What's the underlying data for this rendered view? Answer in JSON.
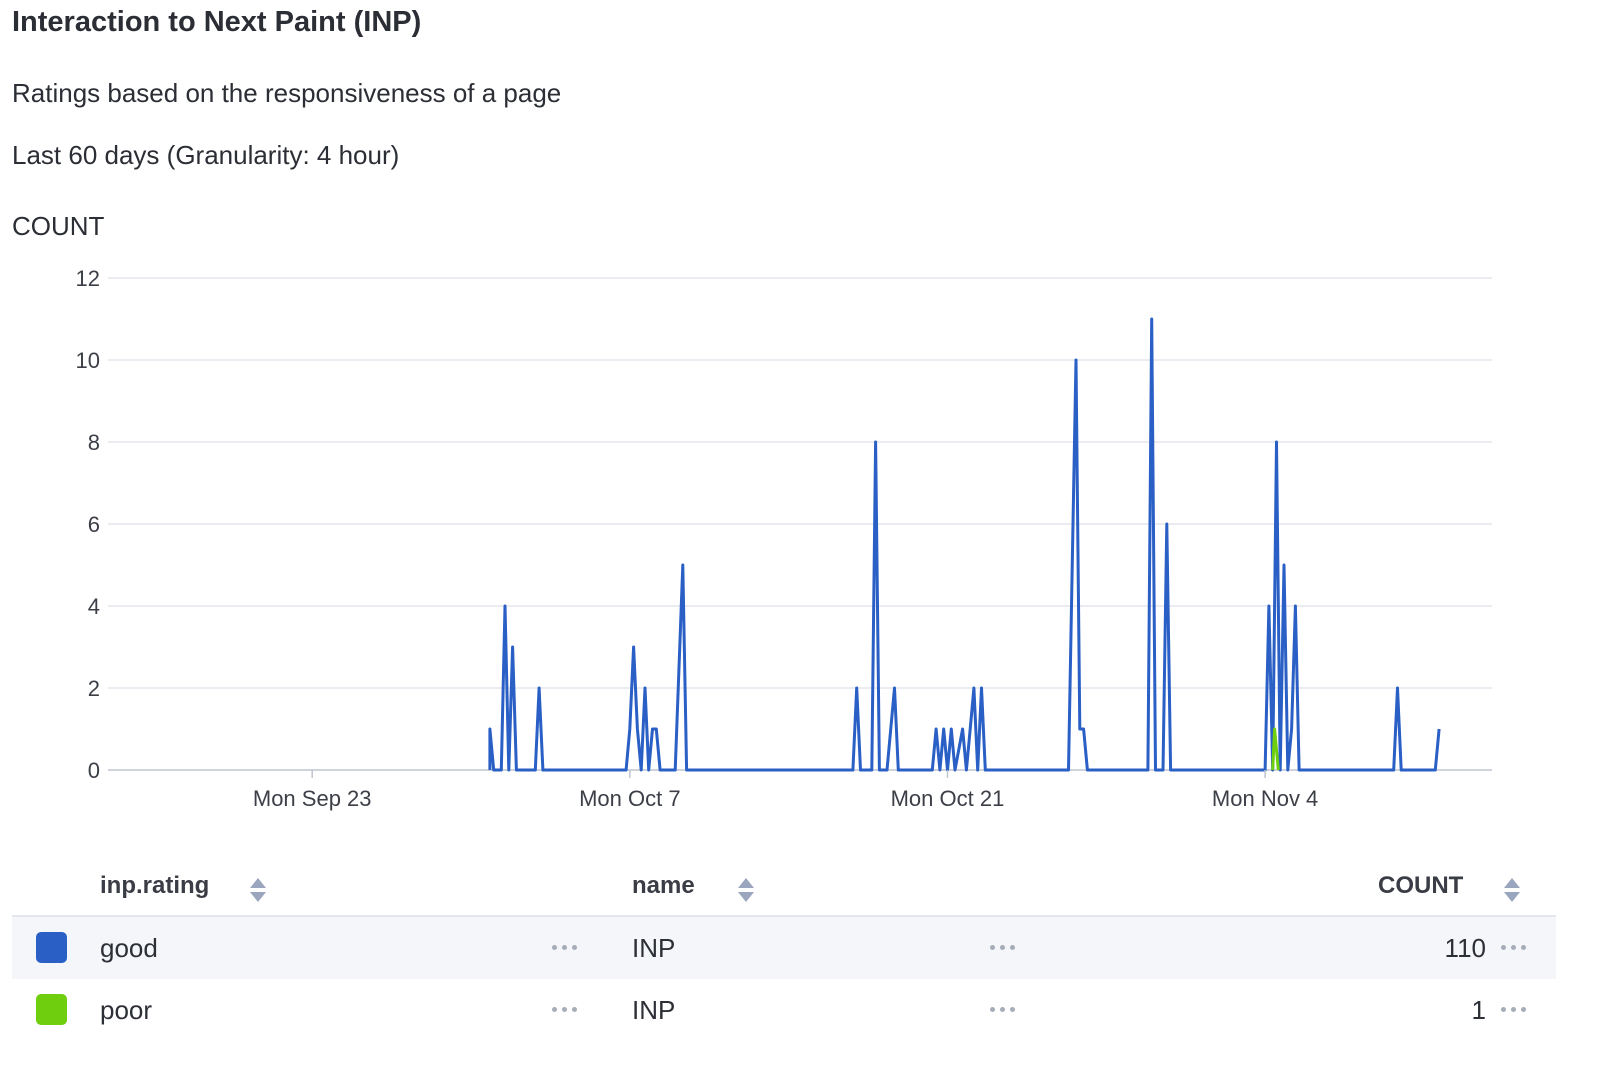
{
  "title": "Interaction to Next Paint (INP)",
  "subtitle": "Ratings based on the responsiveness of a page",
  "time_range": "Last 60 days (Granularity: 4 hour)",
  "y_axis_label": "COUNT",
  "colors": {
    "good": "#2a5fc5",
    "poor": "#6fcf0e",
    "grid": "#e3e6ee",
    "axis": "#bfc5d1"
  },
  "chart_data": {
    "type": "line",
    "title": "Interaction to Next Paint (INP)",
    "ylabel": "COUNT",
    "ylim": [
      0,
      12
    ],
    "yticks": [
      "0",
      "2",
      "4",
      "6",
      "8",
      "10",
      "12"
    ],
    "xlim": [
      "2024-09-14",
      "2024-11-14"
    ],
    "xticks": [
      {
        "label": "Mon Sep 23",
        "x": "2024-09-23"
      },
      {
        "label": "Mon Oct 7",
        "x": "2024-10-07"
      },
      {
        "label": "Mon Oct 21",
        "x": "2024-10-21"
      },
      {
        "label": "Mon Nov 4",
        "x": "2024-11-04"
      }
    ],
    "grid": true,
    "series": [
      {
        "name": "good",
        "color": "#2a5fc5",
        "points": [
          [
            "2024-09-30 20:00",
            0
          ],
          [
            "2024-09-30 20:00",
            1
          ],
          [
            "2024-09-31 00:00",
            0
          ],
          [
            "2024-10-01 08:00",
            0
          ],
          [
            "2024-10-01 12:00",
            4
          ],
          [
            "2024-10-01 16:00",
            0
          ],
          [
            "2024-10-01 20:00",
            3
          ],
          [
            "2024-10-02 00:00",
            0
          ],
          [
            "2024-10-02 20:00",
            0
          ],
          [
            "2024-10-03 00:00",
            2
          ],
          [
            "2024-10-03 04:00",
            0
          ],
          [
            "2024-10-06 20:00",
            0
          ],
          [
            "2024-10-07 00:00",
            1
          ],
          [
            "2024-10-07 04:00",
            3
          ],
          [
            "2024-10-07 08:00",
            1
          ],
          [
            "2024-10-07 12:00",
            0
          ],
          [
            "2024-10-07 16:00",
            2
          ],
          [
            "2024-10-07 20:00",
            0
          ],
          [
            "2024-10-08 00:00",
            1
          ],
          [
            "2024-10-08 04:00",
            1
          ],
          [
            "2024-10-08 08:00",
            0
          ],
          [
            "2024-10-09 00:00",
            0
          ],
          [
            "2024-10-09 08:00",
            5
          ],
          [
            "2024-10-09 12:00",
            0
          ],
          [
            "2024-10-16 20:00",
            0
          ],
          [
            "2024-10-17 00:00",
            2
          ],
          [
            "2024-10-17 04:00",
            0
          ],
          [
            "2024-10-17 16:00",
            0
          ],
          [
            "2024-10-17 20:00",
            8
          ],
          [
            "2024-10-18 00:00",
            0
          ],
          [
            "2024-10-18 08:00",
            0
          ],
          [
            "2024-10-18 16:00",
            2
          ],
          [
            "2024-10-18 20:00",
            0
          ],
          [
            "2024-10-20 08:00",
            0
          ],
          [
            "2024-10-20 12:00",
            1
          ],
          [
            "2024-10-20 16:00",
            0
          ],
          [
            "2024-10-20 20:00",
            1
          ],
          [
            "2024-10-21 00:00",
            0
          ],
          [
            "2024-10-21 04:00",
            1
          ],
          [
            "2024-10-21 08:00",
            0
          ],
          [
            "2024-10-21 16:00",
            1
          ],
          [
            "2024-10-21 20:00",
            0
          ],
          [
            "2024-10-22 00:00",
            1
          ],
          [
            "2024-10-22 04:00",
            2
          ],
          [
            "2024-10-22 08:00",
            0
          ],
          [
            "2024-10-22 12:00",
            2
          ],
          [
            "2024-10-22 16:00",
            0
          ],
          [
            "2024-10-26 08:00",
            0
          ],
          [
            "2024-10-26 16:00",
            10
          ],
          [
            "2024-10-26 20:00",
            1
          ],
          [
            "2024-10-27 00:00",
            1
          ],
          [
            "2024-10-27 04:00",
            0
          ],
          [
            "2024-10-29 20:00",
            0
          ],
          [
            "2024-10-30 00:00",
            11
          ],
          [
            "2024-10-30 04:00",
            0
          ],
          [
            "2024-10-30 12:00",
            0
          ],
          [
            "2024-10-30 16:00",
            6
          ],
          [
            "2024-10-30 20:00",
            0
          ],
          [
            "2024-11-04 00:00",
            0
          ],
          [
            "2024-11-04 04:00",
            4
          ],
          [
            "2024-11-04 08:00",
            0
          ],
          [
            "2024-11-04 12:00",
            8
          ],
          [
            "2024-11-04 16:00",
            0
          ],
          [
            "2024-11-04 20:00",
            5
          ],
          [
            "2024-11-05 00:00",
            0
          ],
          [
            "2024-11-05 04:00",
            1
          ],
          [
            "2024-11-05 08:00",
            4
          ],
          [
            "2024-11-05 12:00",
            0
          ],
          [
            "2024-11-09 16:00",
            0
          ],
          [
            "2024-11-09 20:00",
            2
          ],
          [
            "2024-11-10 00:00",
            0
          ],
          [
            "2024-11-11 12:00",
            0
          ],
          [
            "2024-11-11 16:00",
            1
          ]
        ]
      },
      {
        "name": "poor",
        "color": "#6fcf0e",
        "points": [
          [
            "2024-11-04 08:00",
            0
          ],
          [
            "2024-11-04 10:00",
            1
          ],
          [
            "2024-11-04 14:00",
            0
          ]
        ]
      }
    ]
  },
  "table": {
    "headers": {
      "rating": "inp.rating",
      "name": "name",
      "count": "COUNT"
    },
    "rows": [
      {
        "rating": "good",
        "name": "INP",
        "count": "110",
        "color": "#2a5fc5"
      },
      {
        "rating": "poor",
        "name": "INP",
        "count": "1",
        "color": "#6fcf0e"
      }
    ]
  }
}
